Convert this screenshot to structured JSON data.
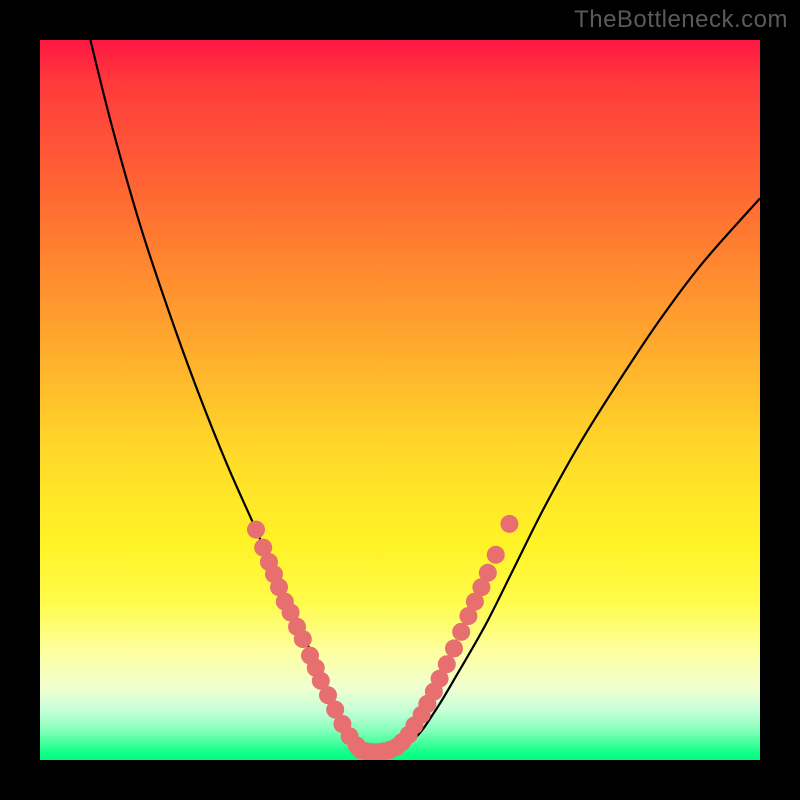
{
  "watermark": "TheBottleneck.com",
  "chart_data": {
    "type": "line",
    "title": "",
    "xlabel": "",
    "ylabel": "",
    "xlim": [
      0,
      100
    ],
    "ylim": [
      0,
      100
    ],
    "gradient_zones": [
      {
        "label": "red-high",
        "y_range": [
          70,
          100
        ],
        "color": "#ff1744"
      },
      {
        "label": "orange",
        "y_range": [
          40,
          70
        ],
        "color": "#ff9c2e"
      },
      {
        "label": "yellow",
        "y_range": [
          10,
          40
        ],
        "color": "#ffe428"
      },
      {
        "label": "green-optimal",
        "y_range": [
          0,
          6
        ],
        "color": "#11ff88"
      }
    ],
    "series": [
      {
        "name": "bottleneck-curve",
        "x": [
          7,
          10,
          14,
          18,
          22,
          26,
          30,
          33,
          36,
          38,
          40,
          42,
          44,
          46,
          48,
          52,
          55,
          58,
          62,
          66,
          70,
          75,
          80,
          86,
          92,
          100
        ],
        "y": [
          100,
          88,
          74,
          62,
          51,
          41,
          32,
          25,
          19,
          14,
          10,
          6,
          3,
          1,
          1,
          3,
          7,
          12,
          19,
          27,
          35,
          44,
          52,
          61,
          69,
          78
        ]
      }
    ],
    "marker_clusters": [
      {
        "name": "left-cluster",
        "points": [
          {
            "x": 30.0,
            "y": 32.0
          },
          {
            "x": 31.0,
            "y": 29.5
          },
          {
            "x": 31.8,
            "y": 27.5
          },
          {
            "x": 32.5,
            "y": 25.8
          },
          {
            "x": 33.2,
            "y": 24.0
          },
          {
            "x": 34.0,
            "y": 22.0
          },
          {
            "x": 34.8,
            "y": 20.5
          },
          {
            "x": 35.7,
            "y": 18.5
          },
          {
            "x": 36.5,
            "y": 16.8
          },
          {
            "x": 37.5,
            "y": 14.5
          },
          {
            "x": 38.3,
            "y": 12.8
          },
          {
            "x": 39.0,
            "y": 11.0
          },
          {
            "x": 40.0,
            "y": 9.0
          },
          {
            "x": 41.0,
            "y": 7.0
          },
          {
            "x": 42.0,
            "y": 5.0
          },
          {
            "x": 43.0,
            "y": 3.3
          },
          {
            "x": 44.0,
            "y": 2.0
          }
        ]
      },
      {
        "name": "bottom-flat",
        "points": [
          {
            "x": 44.5,
            "y": 1.4
          },
          {
            "x": 45.3,
            "y": 1.2
          },
          {
            "x": 46.1,
            "y": 1.1
          },
          {
            "x": 46.9,
            "y": 1.1
          },
          {
            "x": 47.7,
            "y": 1.2
          },
          {
            "x": 48.6,
            "y": 1.4
          },
          {
            "x": 49.5,
            "y": 1.8
          }
        ]
      },
      {
        "name": "right-cluster",
        "points": [
          {
            "x": 50.3,
            "y": 2.5
          },
          {
            "x": 51.2,
            "y": 3.5
          },
          {
            "x": 52.0,
            "y": 4.8
          },
          {
            "x": 53.0,
            "y": 6.3
          },
          {
            "x": 53.8,
            "y": 7.8
          },
          {
            "x": 54.7,
            "y": 9.5
          },
          {
            "x": 55.5,
            "y": 11.3
          },
          {
            "x": 56.5,
            "y": 13.3
          },
          {
            "x": 57.5,
            "y": 15.5
          },
          {
            "x": 58.5,
            "y": 17.8
          },
          {
            "x": 59.5,
            "y": 20.0
          },
          {
            "x": 60.4,
            "y": 22.0
          },
          {
            "x": 61.3,
            "y": 24.0
          },
          {
            "x": 62.2,
            "y": 26.0
          },
          {
            "x": 63.3,
            "y": 28.5
          },
          {
            "x": 65.2,
            "y": 32.8
          }
        ]
      }
    ],
    "curve_color": "#000000",
    "marker_color": "#e76f6f",
    "marker_radius": 9
  }
}
